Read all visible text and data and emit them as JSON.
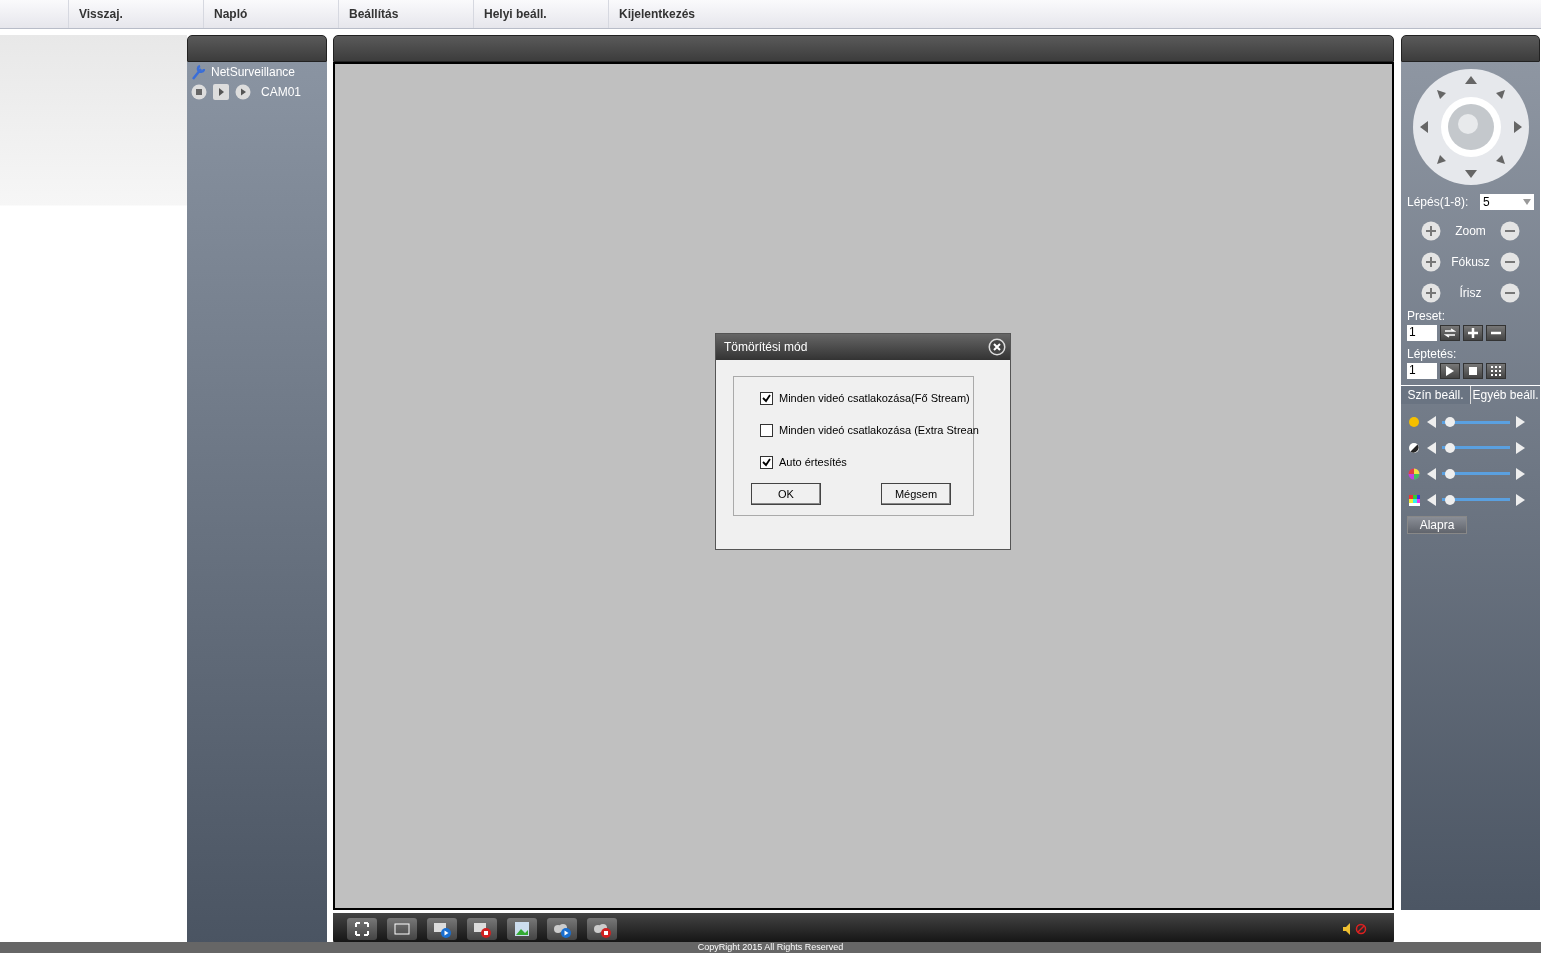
{
  "nav": [
    {
      "label": "Visszaj."
    },
    {
      "label": "Napló"
    },
    {
      "label": "Beállítás"
    },
    {
      "label": "Helyi beáll."
    },
    {
      "label": "Kijelentkezés"
    }
  ],
  "device_tree": {
    "root": "NetSurveillance",
    "children": [
      {
        "label": "CAM01"
      }
    ]
  },
  "dialog": {
    "title": "Tömörítési mód",
    "options": [
      {
        "label": "Minden videó csatlakozása(Fő Stream)",
        "checked": true
      },
      {
        "label": "Minden videó csatlakozása (Extra Strean",
        "checked": false
      },
      {
        "label": "Auto értesítés",
        "checked": true
      }
    ],
    "buttons": [
      "OK",
      "Mégsem"
    ]
  },
  "ptz": {
    "step_label": "Lépés(1-8):",
    "step_value": "5",
    "controls": [
      "Zoom",
      "Fókusz",
      "Írisz"
    ],
    "preset_label": "Preset:",
    "preset_value": "1",
    "tour_label": "Léptetés:",
    "tour_value": "1"
  },
  "color_tabs": [
    {
      "label": "Szín beáll.",
      "selected": true
    },
    {
      "label": "Egyéb beáll.",
      "selected": false
    }
  ],
  "sliders": [
    {
      "kind": "brightness",
      "level": 0.05
    },
    {
      "kind": "contrast",
      "level": 0.05
    },
    {
      "kind": "saturation",
      "level": 0.05
    },
    {
      "kind": "hue",
      "level": 0.05
    }
  ],
  "reset_button": "Alapra",
  "footer": "CopyRight 2015 All Rights Reserved"
}
